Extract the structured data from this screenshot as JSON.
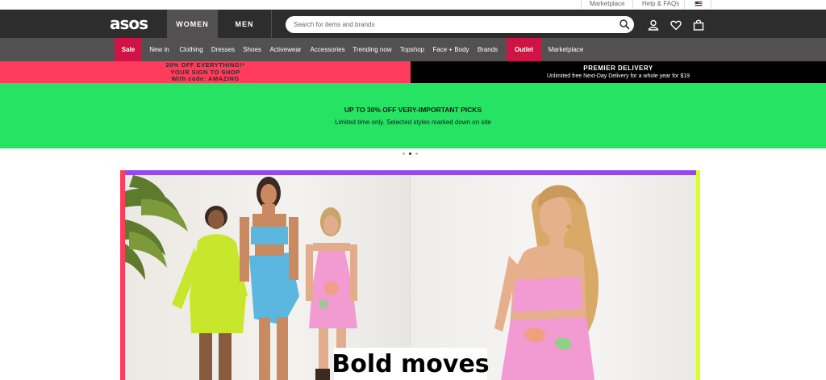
{
  "util_bar": {
    "marketplace_label": "Marketplace",
    "help_label": "Help & FAQs",
    "country_flag": "us-flag-icon"
  },
  "header": {
    "logo": "asos",
    "tabs": [
      {
        "label": "WOMEN",
        "active": true
      },
      {
        "label": "MEN",
        "active": false
      }
    ],
    "search_placeholder": "Search for items and brands",
    "icons": [
      "search-icon",
      "account-icon",
      "heart-icon",
      "bag-icon"
    ]
  },
  "category_nav": [
    {
      "label": "Sale"
    },
    {
      "label": "New in"
    },
    {
      "label": "Clothing"
    },
    {
      "label": "Dresses"
    },
    {
      "label": "Shoes"
    },
    {
      "label": "Activewear"
    },
    {
      "label": "Accessories"
    },
    {
      "label": "Trending now"
    },
    {
      "label": "Topshop"
    },
    {
      "label": "Face + Body"
    },
    {
      "label": "Brands"
    },
    {
      "label": "Outlet"
    },
    {
      "label": "Marketplace"
    }
  ],
  "promo": {
    "left_line1": "20% OFF EVERYTHING!*",
    "left_line2": "YOUR SIGN TO SHOP",
    "left_line3": "With code: AMAZING",
    "right_title": "PREMIER DELIVERY",
    "right_subtitle": "Unlimited free Next-Day Delivery for a whole year for $19"
  },
  "hero_banner": {
    "title": "UP TO 30% OFF VERY-IMPORTANT PICKS",
    "subtitle": "Limited time only. Selected styles marked down on site"
  },
  "carousel": {
    "dots": 3,
    "active": 2
  },
  "hero": {
    "headline": "Bold moves"
  },
  "colors": {
    "header_bg": "#2d2d2d",
    "nav_bg": "#525050",
    "sale_red": "#d01345",
    "promo_pink": "#ff3c5c",
    "banner_green": "#26e364",
    "hero_purple": "#9448f2",
    "hero_lime": "#d9ff2b"
  }
}
